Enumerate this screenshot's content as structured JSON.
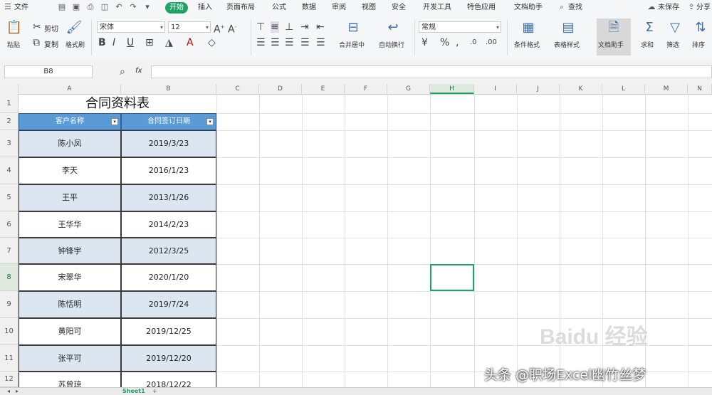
{
  "app": {
    "menu_label": "文件",
    "unsaved_label": "未保存",
    "share_label": "分享"
  },
  "tabs": [
    {
      "label": "开始",
      "active": true
    },
    {
      "label": "插入"
    },
    {
      "label": "页面布局"
    },
    {
      "label": "公式"
    },
    {
      "label": "数据"
    },
    {
      "label": "审阅"
    },
    {
      "label": "视图"
    },
    {
      "label": "安全"
    },
    {
      "label": "开发工具"
    },
    {
      "label": "特色应用"
    },
    {
      "label": "文档助手"
    },
    {
      "label": "查找"
    }
  ],
  "ribbon": {
    "paste": "粘贴",
    "cut": "剪切",
    "copy": "复制",
    "format_painter": "格式刷",
    "font_name": "宋体",
    "font_size": "12",
    "number_format": "常规",
    "merge_center": "合并居中",
    "wrap": "自动换行",
    "cond_format": "条件格式",
    "table_style": "表格样式",
    "doc_helper": "文档助手",
    "sum": "求和",
    "filter": "筛选",
    "sort": "排序"
  },
  "formula": {
    "name_box": "B8",
    "fx": "fx"
  },
  "columns": [
    "A",
    "B",
    "C",
    "D",
    "E",
    "F",
    "G",
    "H",
    "I",
    "J",
    "K",
    "L",
    "M",
    "N"
  ],
  "rows": [
    "1",
    "2",
    "3",
    "4",
    "5",
    "6",
    "7",
    "8",
    "9",
    "10",
    "11",
    "12"
  ],
  "table": {
    "title": "合同资料表",
    "headers": [
      "客户名称",
      "合同签订日期"
    ],
    "rows": [
      [
        "陈小凤",
        "2019/3/23"
      ],
      [
        "李天",
        "2016/1/23"
      ],
      [
        "王平",
        "2013/1/26"
      ],
      [
        "王华华",
        "2014/2/23"
      ],
      [
        "钟锋宇",
        "2012/3/25"
      ],
      [
        "宋翠华",
        "2020/1/20"
      ],
      [
        "陈恬明",
        "2019/7/24"
      ],
      [
        "黄阳可",
        "2019/12/25"
      ],
      [
        "张平可",
        "2019/12/20"
      ],
      [
        "苏曾琼",
        "2018/12/22"
      ]
    ]
  },
  "sheets": [
    "Sheet1"
  ],
  "watermark": "头条 @职场Excel幽竹丝梦",
  "baidu_logo": "Baidu 经验"
}
